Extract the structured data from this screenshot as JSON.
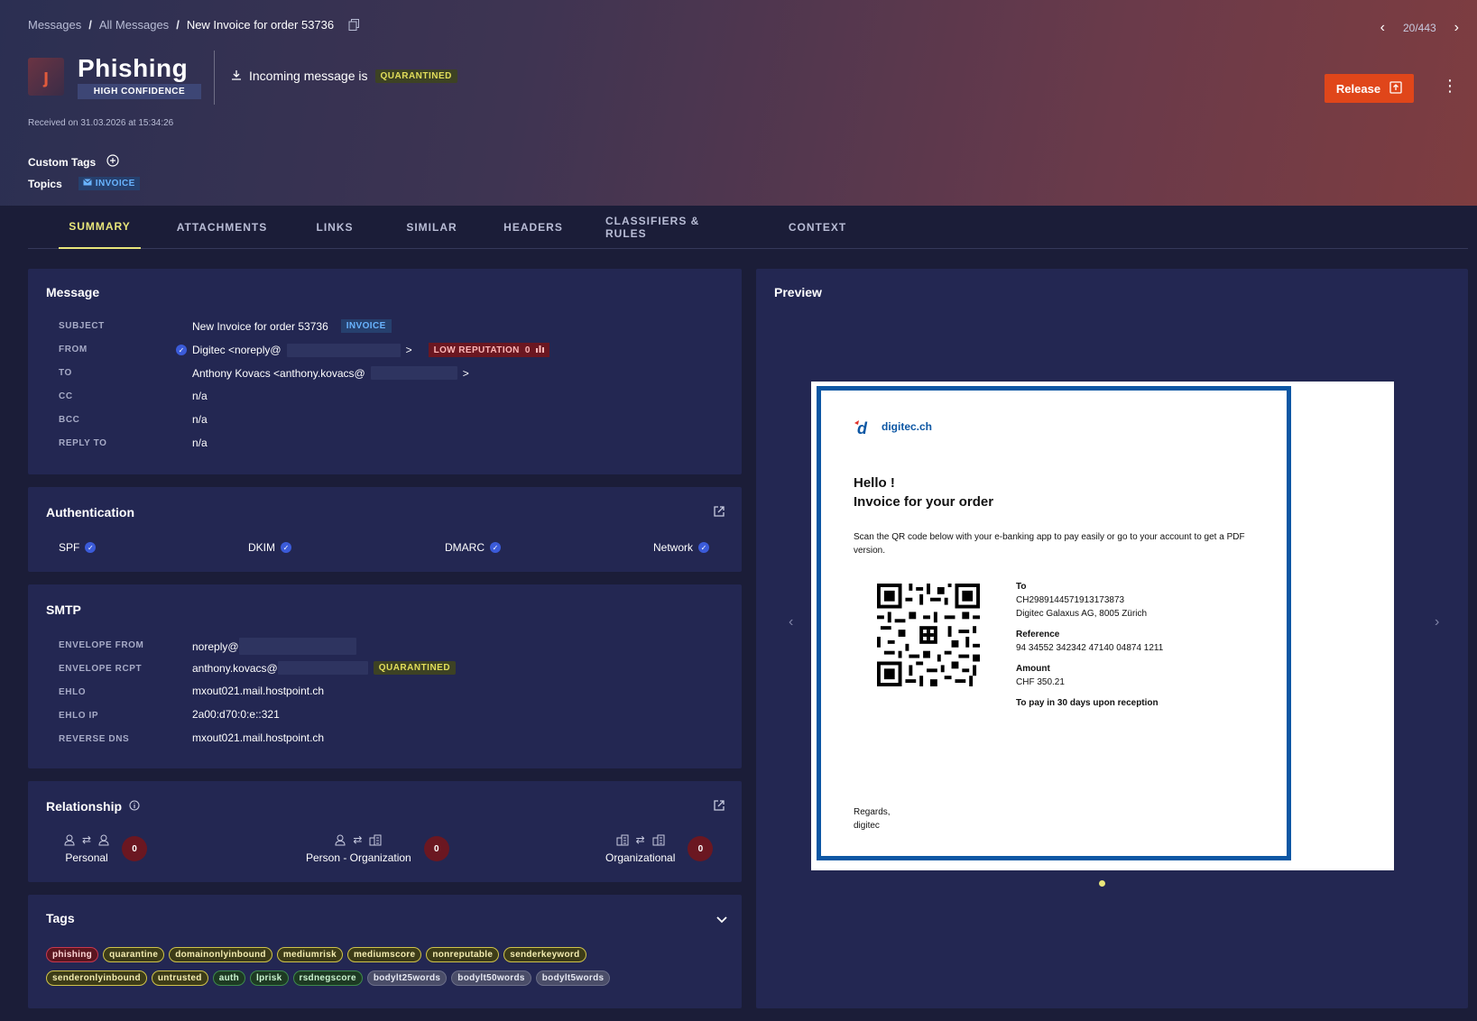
{
  "breadcrumb": {
    "root": "Messages",
    "sep1": "/",
    "section": "All Messages",
    "sep2": "/",
    "current": "New Invoice for order 53736"
  },
  "pager": {
    "position": "20/443"
  },
  "header": {
    "verdict": "Phishing",
    "confidence": "HIGH CONFIDENCE",
    "incoming_text": "Incoming message is",
    "status": "QUARANTINED",
    "received": "Received on 31.03.2026 at 15:34:26",
    "release_label": "Release",
    "custom_tags_label": "Custom Tags",
    "topics_label": "Topics",
    "topic": "INVOICE"
  },
  "tabs": [
    {
      "label": "SUMMARY",
      "active": true
    },
    {
      "label": "ATTACHMENTS"
    },
    {
      "label": "LINKS"
    },
    {
      "label": "SIMILAR"
    },
    {
      "label": "HEADERS"
    },
    {
      "label": "CLASSIFIERS & RULES"
    },
    {
      "label": "CONTEXT"
    }
  ],
  "message": {
    "title": "Message",
    "rows": [
      {
        "label": "SUBJECT",
        "value": "New Invoice for order 53736",
        "badge": "INVOICE"
      },
      {
        "label": "FROM",
        "value": "Digitec <noreply@",
        "suffix": ">",
        "badge": "LOW REPUTATION",
        "count": "0"
      },
      {
        "label": "TO",
        "value": "Anthony Kovacs <anthony.kovacs@",
        "suffix": ">"
      },
      {
        "label": "CC",
        "value": "n/a"
      },
      {
        "label": "BCC",
        "value": "n/a"
      },
      {
        "label": "REPLY TO",
        "value": "n/a"
      }
    ]
  },
  "authentication": {
    "title": "Authentication",
    "items": [
      "SPF",
      "DKIM",
      "DMARC",
      "Network"
    ]
  },
  "smtp": {
    "title": "SMTP",
    "rows": [
      {
        "label": "ENVELOPE FROM",
        "value": "noreply@"
      },
      {
        "label": "ENVELOPE RCPT",
        "value": "anthony.kovacs@",
        "badge": "QUARANTINED"
      },
      {
        "label": "EHLO",
        "value": "mxout021.mail.hostpoint.ch"
      },
      {
        "label": "EHLO IP",
        "value": "2a00:d70:0:e::321"
      },
      {
        "label": "REVERSE DNS",
        "value": "mxout021.mail.hostpoint.ch"
      }
    ]
  },
  "relationship": {
    "title": "Relationship",
    "groups": [
      {
        "label": "Personal",
        "count": "0"
      },
      {
        "label": "Person - Organization",
        "count": "0"
      },
      {
        "label": "Organizational",
        "count": "0"
      }
    ]
  },
  "tags": {
    "title": "Tags",
    "row1": [
      {
        "label": "phishing",
        "color": "red"
      },
      {
        "label": "quarantine",
        "color": "yel"
      },
      {
        "label": "domainonlyinbound",
        "color": "yel"
      },
      {
        "label": "mediumrisk",
        "color": "yel"
      },
      {
        "label": "mediumscore",
        "color": "yel"
      },
      {
        "label": "nonreputable",
        "color": "yel"
      },
      {
        "label": "senderkeyword",
        "color": "yel"
      }
    ],
    "row2": [
      {
        "label": "senderonlyinbound",
        "color": "yel"
      },
      {
        "label": "untrusted",
        "color": "yel"
      },
      {
        "label": "auth",
        "color": "grn"
      },
      {
        "label": "lprisk",
        "color": "grn"
      },
      {
        "label": "rsdnegscore",
        "color": "grn"
      },
      {
        "label": "bodylt25words",
        "color": "gry"
      },
      {
        "label": "bodylt50words",
        "color": "gry"
      },
      {
        "label": "bodylt5words",
        "color": "gry"
      }
    ]
  },
  "preview": {
    "title": "Preview",
    "brand": "digitec.ch",
    "hello": "Hello !",
    "heading": "Invoice for your order",
    "body": "Scan the QR code below with your e-banking app to pay easily or go to your account to get a PDF version.",
    "to_label": "To",
    "to_iban": "CH2989144571913173873",
    "to_name": "Digitec Galaxus AG, 8005 Zürich",
    "ref_label": "Reference",
    "ref_value": "94 34552 342342 47140 04874 1211",
    "amount_label": "Amount",
    "amount_value": "CHF 350.21",
    "pay_note": "To pay in 30 days upon reception",
    "regards": "Regards,",
    "signature": "digitec"
  },
  "colors": {
    "accent": "#e9e67a",
    "release": "#e0461a",
    "danger": "#6b1721",
    "brand": "#0d57a4"
  }
}
